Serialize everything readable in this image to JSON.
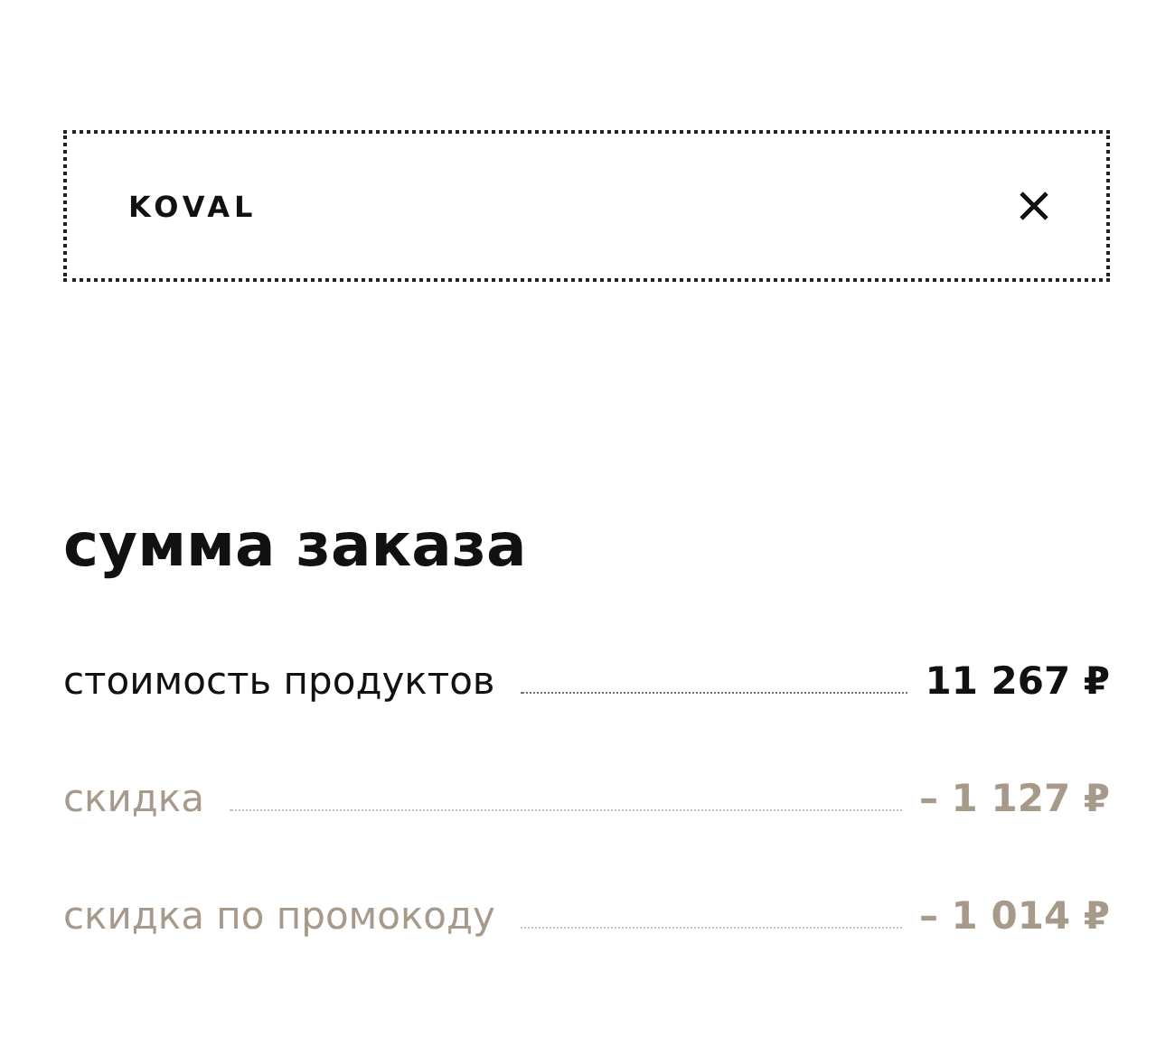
{
  "promo_field": {
    "value": "KOVAL"
  },
  "summary": {
    "title": "сумма заказа",
    "rows": [
      {
        "kind": "total",
        "label": "стоимость продуктов",
        "amount": "11 267 ₽"
      },
      {
        "kind": "discount",
        "label": "скидка",
        "amount": "– 1 127 ₽"
      },
      {
        "kind": "discount",
        "label": "скидка по промокоду",
        "amount": "– 1 014 ₽"
      }
    ]
  }
}
